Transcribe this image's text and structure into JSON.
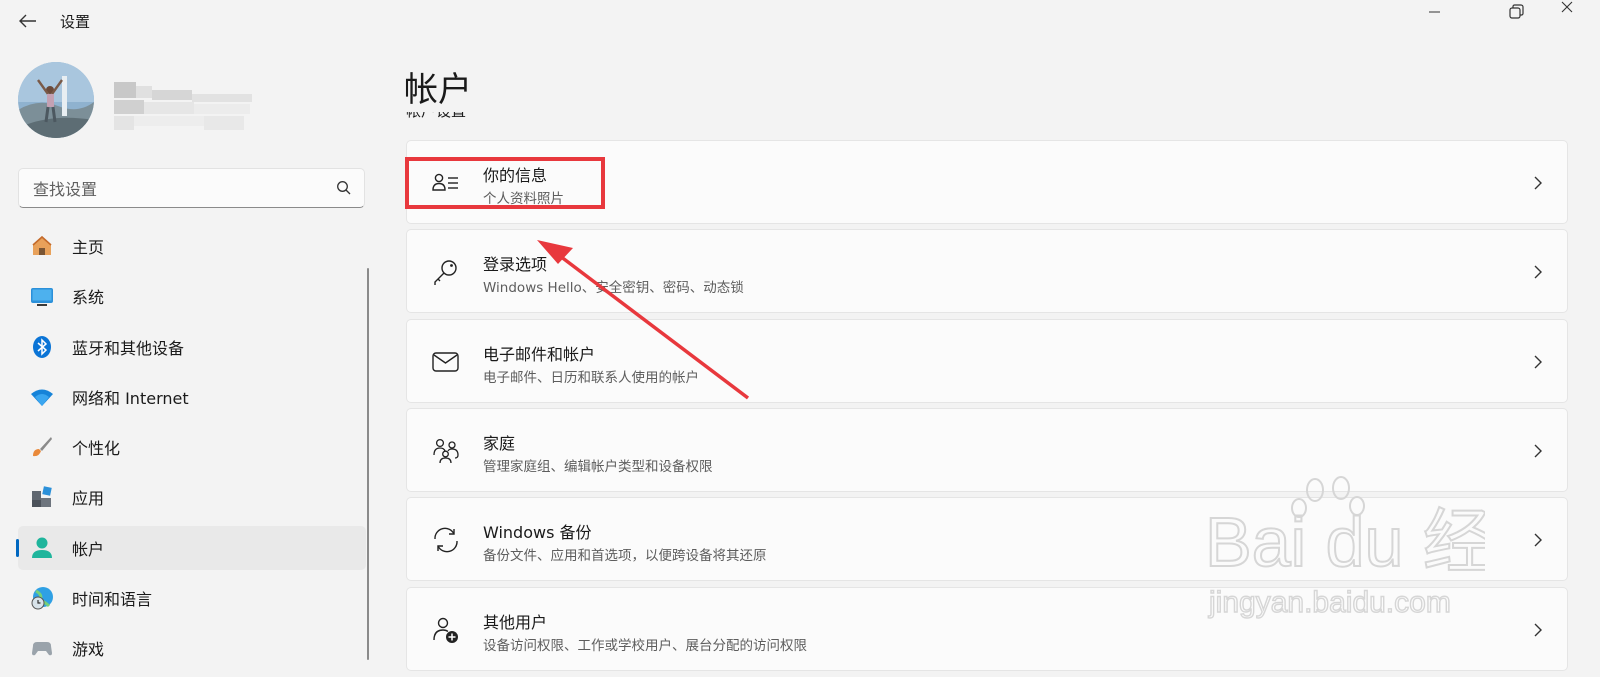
{
  "app": {
    "title": "设置"
  },
  "search": {
    "placeholder": "查找设置"
  },
  "sidebar": {
    "items": [
      {
        "label": "主页",
        "icon": "home-icon"
      },
      {
        "label": "系统",
        "icon": "system-display-icon"
      },
      {
        "label": "蓝牙和其他设备",
        "icon": "bluetooth-icon"
      },
      {
        "label": "网络和 Internet",
        "icon": "wifi-icon"
      },
      {
        "label": "个性化",
        "icon": "brush-icon"
      },
      {
        "label": "应用",
        "icon": "apps-icon"
      },
      {
        "label": "帐户",
        "icon": "account-icon",
        "selected": true
      },
      {
        "label": "时间和语言",
        "icon": "time-language-icon"
      },
      {
        "label": "游戏",
        "icon": "gaming-icon"
      }
    ]
  },
  "main": {
    "title": "帐户",
    "section_label": "帐户设置",
    "cards": [
      {
        "title": "你的信息",
        "subtitle": "个人资料照片",
        "icon": "person-info-icon"
      },
      {
        "title": "登录选项",
        "subtitle": "Windows Hello、安全密钥、密码、动态锁",
        "icon": "key-icon"
      },
      {
        "title": "电子邮件和帐户",
        "subtitle": "电子邮件、日历和联系人使用的帐户",
        "icon": "mail-icon"
      },
      {
        "title": "家庭",
        "subtitle": "管理家庭组、编辑帐户类型和设备权限",
        "icon": "family-icon"
      },
      {
        "title": "Windows 备份",
        "subtitle": "备份文件、应用和首选项，以便跨设备将其还原",
        "icon": "backup-sync-icon"
      },
      {
        "title": "其他用户",
        "subtitle": "设备访问权限、工作或学校用户、展台分配的访问权限",
        "icon": "add-user-icon"
      }
    ]
  },
  "colors": {
    "accent": "#0067c0",
    "annotation": "#e8383d"
  },
  "watermark": {
    "brand_text": "Bai du 经验",
    "url_text": "jingyan.baidu.com"
  }
}
